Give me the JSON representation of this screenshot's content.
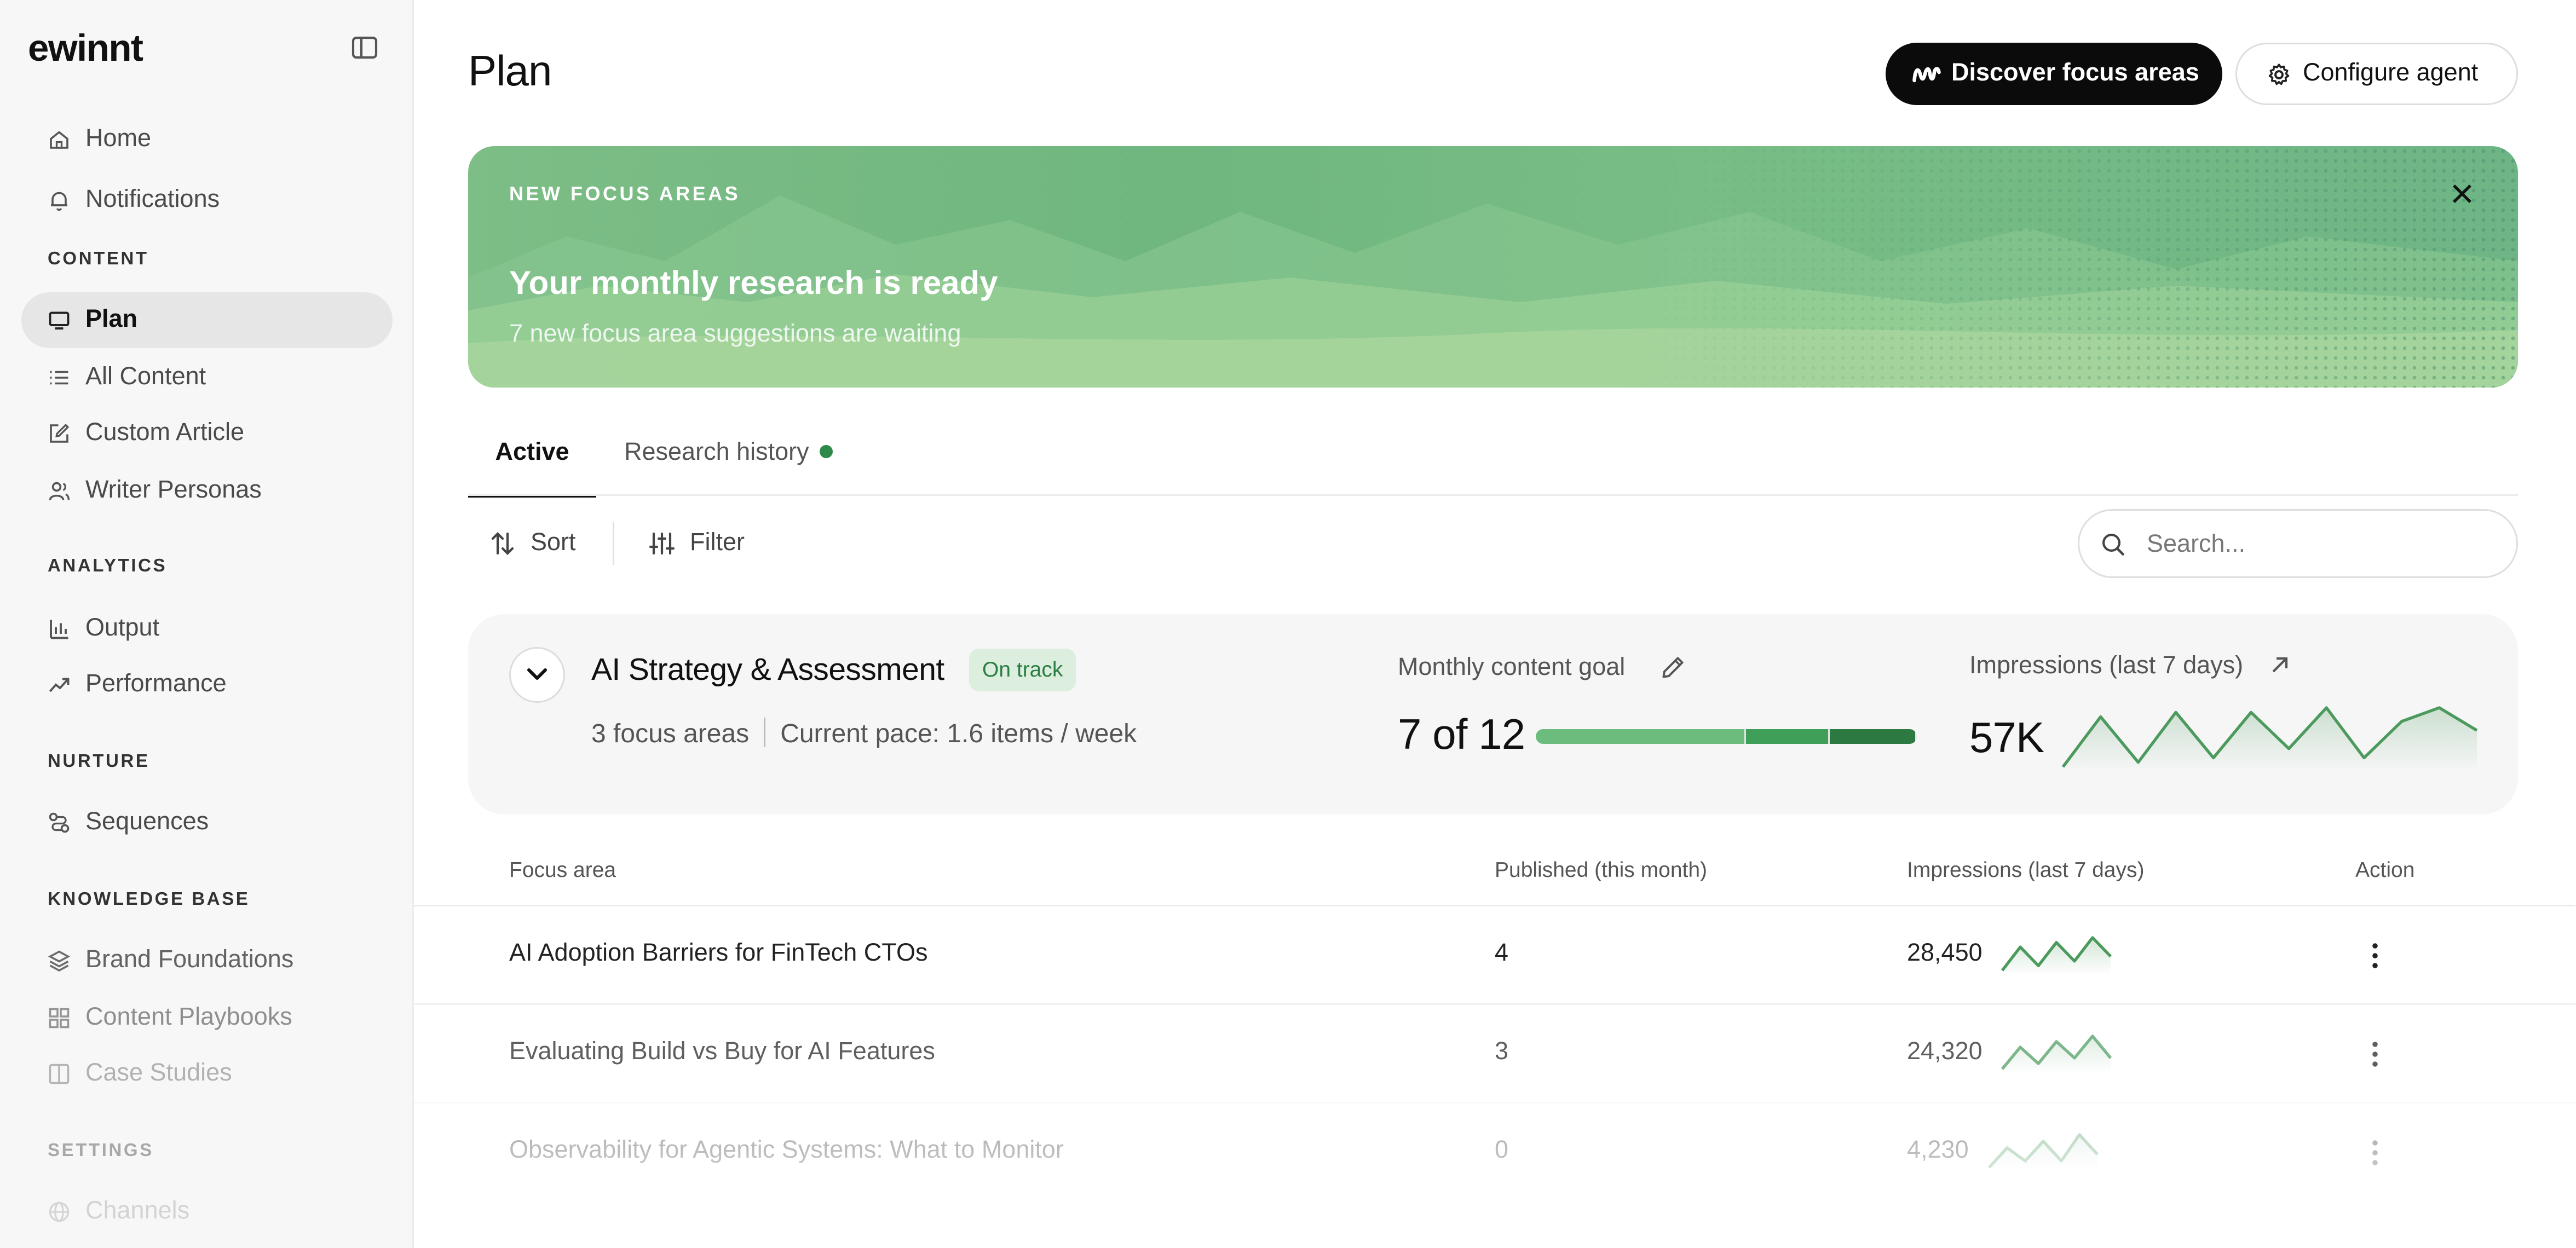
{
  "app": {
    "logo_text": "ewinnt",
    "accent_color": "#2f8a4a"
  },
  "sidebar": {
    "top_items": [
      {
        "label": "Home",
        "icon": "home-icon"
      },
      {
        "label": "Notifications",
        "icon": "bell-icon"
      }
    ],
    "sections": [
      {
        "label": "CONTENT",
        "items": [
          {
            "label": "Plan",
            "icon": "monitor-icon",
            "active": true
          },
          {
            "label": "All Content",
            "icon": "list-icon"
          },
          {
            "label": "Custom Article",
            "icon": "edit-icon"
          },
          {
            "label": "Writer Personas",
            "icon": "users-icon"
          }
        ]
      },
      {
        "label": "ANALYTICS",
        "items": [
          {
            "label": "Output",
            "icon": "bar-chart-icon"
          },
          {
            "label": "Performance",
            "icon": "trending-up-icon"
          }
        ]
      },
      {
        "label": "NURTURE",
        "items": [
          {
            "label": "Sequences",
            "icon": "route-icon"
          }
        ]
      },
      {
        "label": "KNOWLEDGE BASE",
        "items": [
          {
            "label": "Brand Foundations",
            "icon": "layers-icon"
          },
          {
            "label": "Content Playbooks",
            "icon": "grid-icon"
          },
          {
            "label": "Case Studies",
            "icon": "book-icon"
          }
        ]
      },
      {
        "label": "SETTINGS",
        "items": [
          {
            "label": "Channels",
            "icon": "globe-icon"
          }
        ]
      }
    ]
  },
  "header": {
    "title": "Plan",
    "discover_label": "Discover focus areas",
    "configure_label": "Configure agent"
  },
  "banner": {
    "eyebrow": "NEW FOCUS AREAS",
    "title": "Your monthly research is ready",
    "subtitle": "7 new focus area suggestions are waiting"
  },
  "tabs": [
    {
      "label": "Active",
      "active": true
    },
    {
      "label": "Research history",
      "has_dot": true
    }
  ],
  "toolbar": {
    "sort_label": "Sort",
    "filter_label": "Filter",
    "search_placeholder": "Search...",
    "search_value": ""
  },
  "summary": {
    "title": "AI Strategy & Assessment",
    "status": "On track",
    "focus_areas": "3 focus areas",
    "pace": "Current pace: 1.6 items / week",
    "goal_label": "Monthly content goal",
    "goal_value": "7 of 12",
    "goal_completed": 7,
    "goal_total": 12,
    "impressions_label": "Impressions (last 7 days)",
    "impressions_value": "57K",
    "impressions_trend": [
      3,
      14,
      4,
      15,
      5,
      15,
      7,
      16,
      5,
      13,
      16,
      11
    ]
  },
  "table": {
    "columns": [
      "Focus area",
      "Published (this month)",
      "Impressions (last 7 days)",
      "Action"
    ],
    "rows": [
      {
        "focus_area": "AI Adoption Barriers for FinTech CTOs",
        "published": "4",
        "impressions": "28,450",
        "trend": [
          3,
          8,
          4,
          9,
          5,
          10,
          6
        ]
      },
      {
        "focus_area": "Evaluating Build vs Buy for AI Features",
        "published": "3",
        "impressions": "24,320",
        "trend": [
          4,
          8,
          5,
          9,
          6,
          10,
          6
        ]
      },
      {
        "focus_area": "Observability for Agentic Systems: What to Monitor",
        "published": "0",
        "impressions": "4,230",
        "trend": [
          3,
          6,
          4,
          7,
          4,
          8,
          5
        ]
      }
    ]
  }
}
